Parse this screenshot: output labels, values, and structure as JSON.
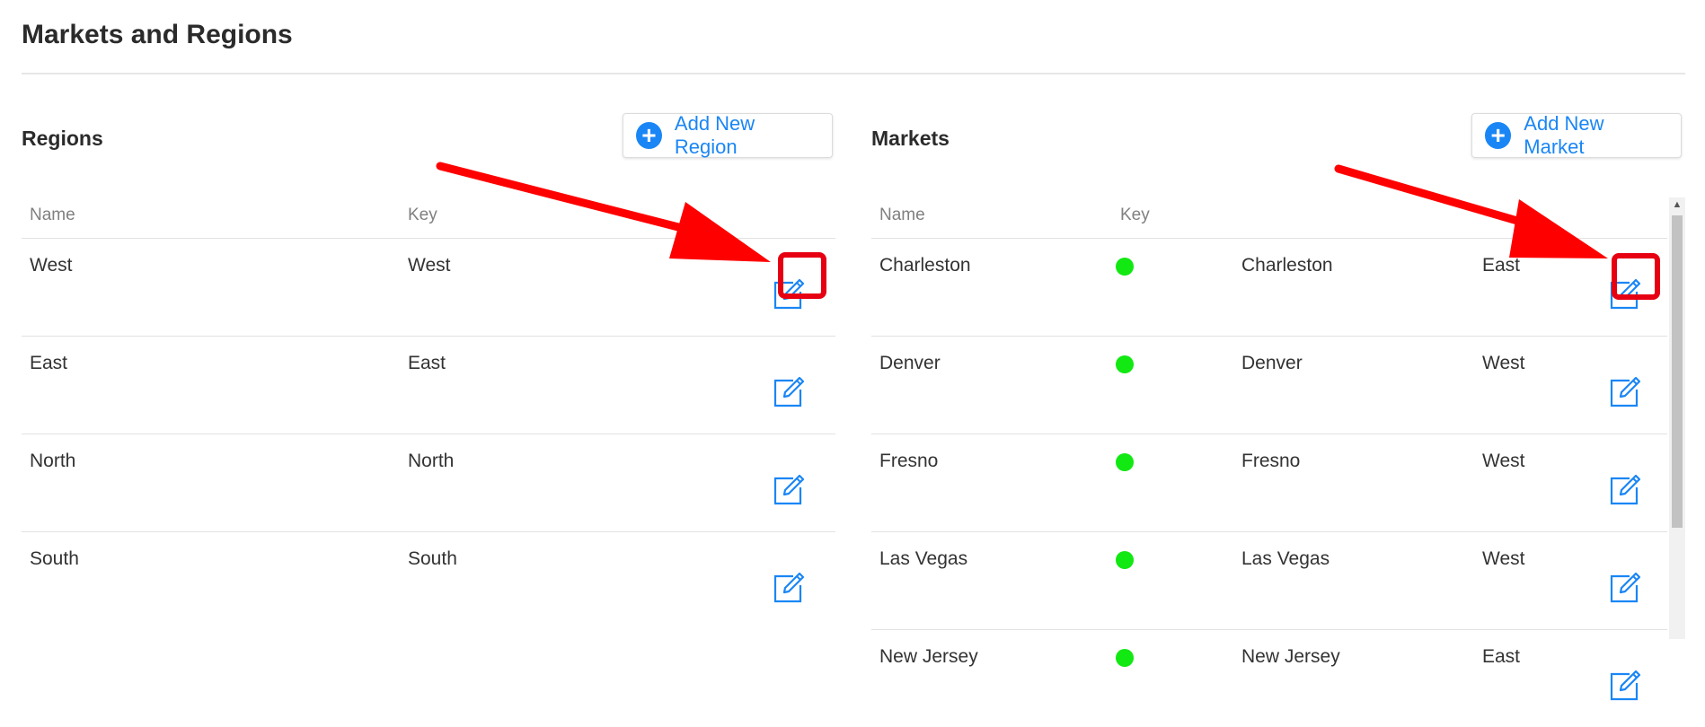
{
  "page": {
    "title": "Markets and Regions"
  },
  "regions": {
    "title": "Regions",
    "add_label": "Add New Region",
    "columns": [
      "Name",
      "Key"
    ],
    "rows": [
      {
        "name": "West",
        "key": "West"
      },
      {
        "name": "East",
        "key": "East"
      },
      {
        "name": "North",
        "key": "North"
      },
      {
        "name": "South",
        "key": "South"
      }
    ]
  },
  "markets": {
    "title": "Markets",
    "add_label": "Add New Market",
    "columns": [
      "Name",
      "Key"
    ],
    "rows": [
      {
        "name": "Charleston",
        "key": "Charleston",
        "region": "East",
        "status": "active"
      },
      {
        "name": "Denver",
        "key": "Denver",
        "region": "West",
        "status": "active"
      },
      {
        "name": "Fresno",
        "key": "Fresno",
        "region": "West",
        "status": "active"
      },
      {
        "name": "Las Vegas",
        "key": "Las Vegas",
        "region": "West",
        "status": "active"
      },
      {
        "name": "New Jersey",
        "key": "New Jersey",
        "region": "East",
        "status": "active"
      }
    ]
  },
  "colors": {
    "accent": "#1a86f5",
    "status_active": "#12e812",
    "annotation": "#e60012"
  },
  "icons": {
    "add": "plus-circle-icon",
    "edit": "edit-pencil-icon"
  }
}
